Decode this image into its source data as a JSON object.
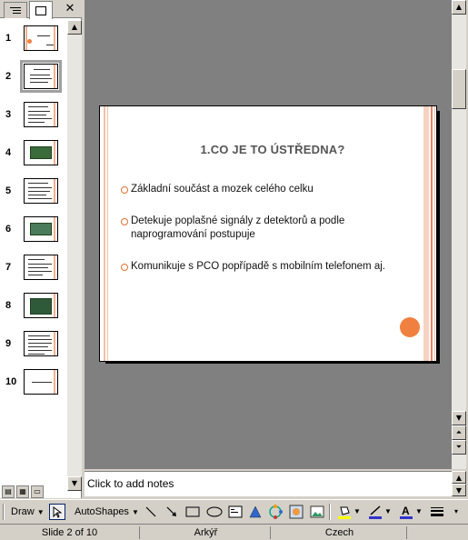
{
  "pane": {
    "close_glyph": "✕",
    "thumbnails": [
      {
        "num": "1"
      },
      {
        "num": "2"
      },
      {
        "num": "3"
      },
      {
        "num": "4"
      },
      {
        "num": "5"
      },
      {
        "num": "6"
      },
      {
        "num": "7"
      },
      {
        "num": "8"
      },
      {
        "num": "9"
      },
      {
        "num": "10"
      }
    ],
    "selected_slide": 2
  },
  "slide": {
    "title": "1.CO JE TO ÚSTŘEDNA?",
    "bullets": [
      "Základní součást a mozek celého celku",
      "Detekuje poplašné signály z detektorů a podle naprogramování postupuje",
      "Komunikuje s PCO popřípadě s mobilním telefonem aj."
    ]
  },
  "notes": {
    "placeholder": "Click to add notes"
  },
  "toolbar": {
    "draw_label": "Draw",
    "autoshapes_label": "AutoShapes"
  },
  "status": {
    "slide_info": "Slide 2 of 10",
    "design": "Arkýř",
    "language": "Czech"
  },
  "colors": {
    "accent": "#f08040",
    "stripe": "#f3c0a8",
    "workspace": "#808080"
  }
}
